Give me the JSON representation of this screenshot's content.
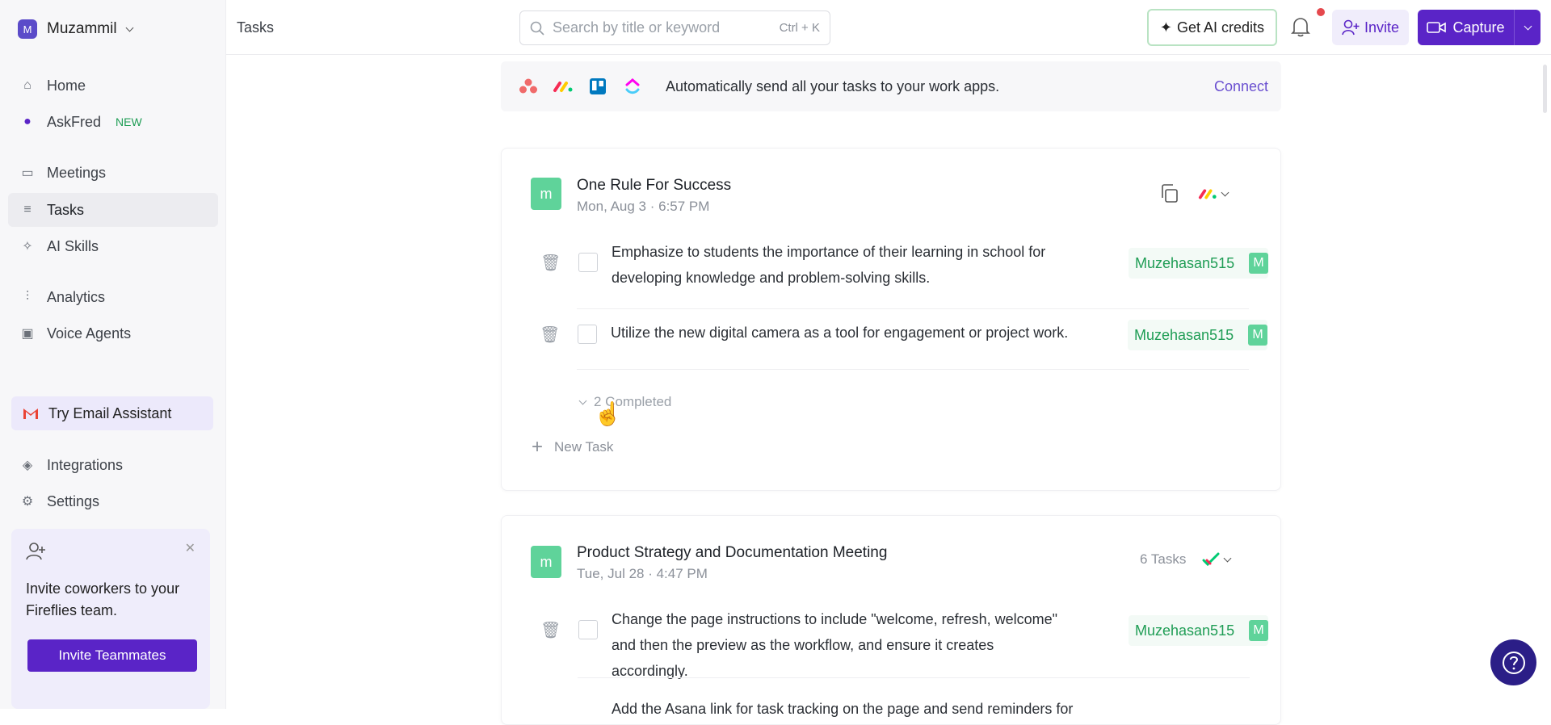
{
  "workspace": {
    "initial": "M",
    "name": "Muzammil"
  },
  "sidebar": {
    "items": [
      {
        "label": "Home",
        "icon": "home-icon",
        "glyph": "⌂"
      },
      {
        "label": "AskFred",
        "icon": "robot-icon",
        "glyph": "●",
        "badge": "NEW"
      },
      {
        "label": "Meetings",
        "icon": "video-icon",
        "glyph": "▭"
      },
      {
        "label": "Tasks",
        "icon": "tasks-icon",
        "glyph": "≡"
      },
      {
        "label": "AI Skills",
        "icon": "sparkle-icon",
        "glyph": "✧"
      },
      {
        "label": "Analytics",
        "icon": "analytics-icon",
        "glyph": "⫶"
      },
      {
        "label": "Voice Agents",
        "icon": "voice-agent-icon",
        "glyph": "▣"
      }
    ],
    "email_assistant": "Try Email Assistant",
    "bottom_items": [
      {
        "label": "Integrations",
        "icon": "layers-icon",
        "glyph": "◈"
      },
      {
        "label": "Settings",
        "icon": "gear-icon",
        "glyph": "⚙"
      }
    ],
    "invite_card": {
      "text": "Invite coworkers to your Fireflies team.",
      "button": "Invite Teammates"
    }
  },
  "header": {
    "page_title": "Tasks",
    "search_placeholder": "Search by title or keyword",
    "search_shortcut": "Ctrl + K",
    "ai_credits": "Get AI credits",
    "invite": "Invite",
    "capture": "Capture"
  },
  "connect_bar": {
    "text": "Automatically send all your tasks to your work apps.",
    "link": "Connect"
  },
  "meetings": [
    {
      "avatar": "m",
      "title": "One Rule For Success",
      "date": "Mon, Aug 3 · 6:57 PM",
      "tasks": [
        {
          "text": "Emphasize to students the importance of their learning in school for developing knowledge and problem-solving skills.",
          "assignee": "Muzehasan515",
          "initial": "M"
        },
        {
          "text": "Utilize the new digital camera as a tool for engagement or project work.",
          "assignee": "Muzehasan515",
          "initial": "M"
        }
      ],
      "completed": "2 Completed",
      "new_task": "New Task"
    },
    {
      "avatar": "m",
      "title": "Product Strategy and Documentation Meeting",
      "date": "Tue, Jul 28 · 4:47 PM",
      "task_count": "6 Tasks",
      "tasks": [
        {
          "text": "Change the page instructions to include \"welcome, refresh, welcome\" and then the preview as the workflow, and ensure it creates accordingly.",
          "assignee": "Muzehasan515",
          "initial": "M"
        },
        {
          "text": "Add the Asana link for task tracking on the page and send reminders for"
        }
      ]
    }
  ],
  "colors": {
    "accent": "#5a24c7",
    "green": "#1f9d55",
    "avatar_green": "#5fd39a",
    "help": "#2b1e87"
  }
}
